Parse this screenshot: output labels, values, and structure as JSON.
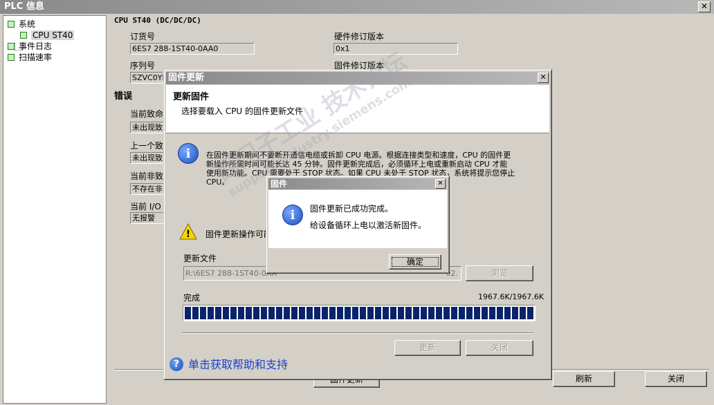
{
  "window": {
    "title": "PLC 信息",
    "close_glyph": "✕"
  },
  "tree": {
    "items": [
      {
        "label": "系统"
      },
      {
        "label": "CPU ST40"
      },
      {
        "label": "事件日志"
      },
      {
        "label": "扫描速率"
      }
    ]
  },
  "main": {
    "cpu_title": "CPU ST40 (DC/DC/DC)",
    "order_no_label": "订货号",
    "order_no_value": "6ES7 288-1ST40-0AA0",
    "hw_version_label": "硬件修订版本",
    "hw_version_value": "0x1",
    "serial_label": "序列号",
    "serial_value": "SZVC0YD",
    "fw_version_label": "固件修订版本",
    "errors_heading": "错误",
    "current_fatal_label": "当前致命",
    "current_fatal_value": "未出现致",
    "last_fatal_label": "上一个致",
    "last_fatal_value": "未出现致",
    "current_nonfatal_label": "当前非致",
    "current_nonfatal_value": "不存在非",
    "current_io_label": "当前 I/O",
    "current_io_value": "无报警",
    "fw_update_button": "固件更新",
    "refresh_button": "刷新",
    "close_button": "关闭"
  },
  "firmware_dialog": {
    "title": "固件更新",
    "close_glyph": "✕",
    "header_title": "更新固件",
    "header_subtitle": "选择要载入 CPU 的固件更新文件",
    "info_lines": [
      "在固件更新期间不要断开通信电缆或拆卸 CPU 电源。根据连接类型和速度，CPU 的固件更",
      "新操作所需时间可能长达 45 分钟。固件更新完成后，必须循环上电或重新启动 CPU 才能",
      "使用新功能。CPU 需要处于 STOP 状态。如果 CPU 未处于 STOP 状态，系统将提示您停止",
      "CPU。"
    ],
    "warning_text": "固件更新操作可能",
    "file_label": "更新文件",
    "file_value": "R:\\6ES7 288-1ST40-0AA",
    "file_value_tail": "02.",
    "browse_button": "浏览",
    "complete_label": "完成",
    "progress_text": "1967.6K/1967.6K",
    "progress_fraction": 1.0,
    "update_button": "更新",
    "close_button": "关闭",
    "help_link": "单击获取帮助和支持"
  },
  "message_box": {
    "title": "固件",
    "close_glyph": "✕",
    "line1": "固件更新已成功完成。",
    "line2": "给设备循环上电以激活新固件。",
    "ok_button": "确定"
  },
  "watermark": {
    "text1": "西门子工业 技术论坛",
    "text2": "support.industry.siemens.com"
  },
  "icons": {
    "info": "i",
    "warning": "!",
    "help": "?"
  }
}
